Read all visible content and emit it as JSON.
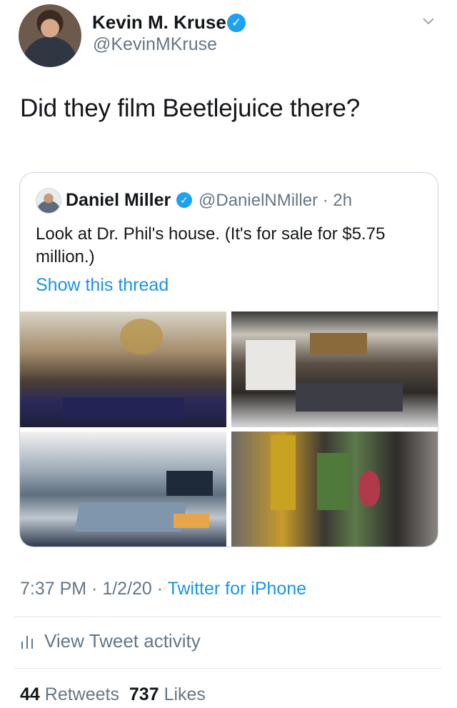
{
  "tweet": {
    "author_name": "Kevin M. Kruse",
    "author_handle": "@KevinMKruse",
    "verified_icon": "verified-badge-icon",
    "text": "Did they film Beetlejuice there?",
    "timestamp": "7:37 PM · 1/2/20 · ",
    "source": "Twitter for iPhone",
    "activity_label": "View Tweet activity",
    "retweets_count": "44",
    "retweets_label": "Retweets",
    "likes_count": "737",
    "likes_label": "Likes"
  },
  "quoted": {
    "author_name": "Daniel Miller",
    "author_handle": "@DanielNMiller · 2h",
    "text": "Look at Dr. Phil's house. (It's for sale for $5.75 million.)",
    "thread_link": "Show this thread"
  },
  "colors": {
    "link_blue": "#1b95e0",
    "verified_blue": "#1da1f2",
    "muted_gray": "#657786"
  }
}
